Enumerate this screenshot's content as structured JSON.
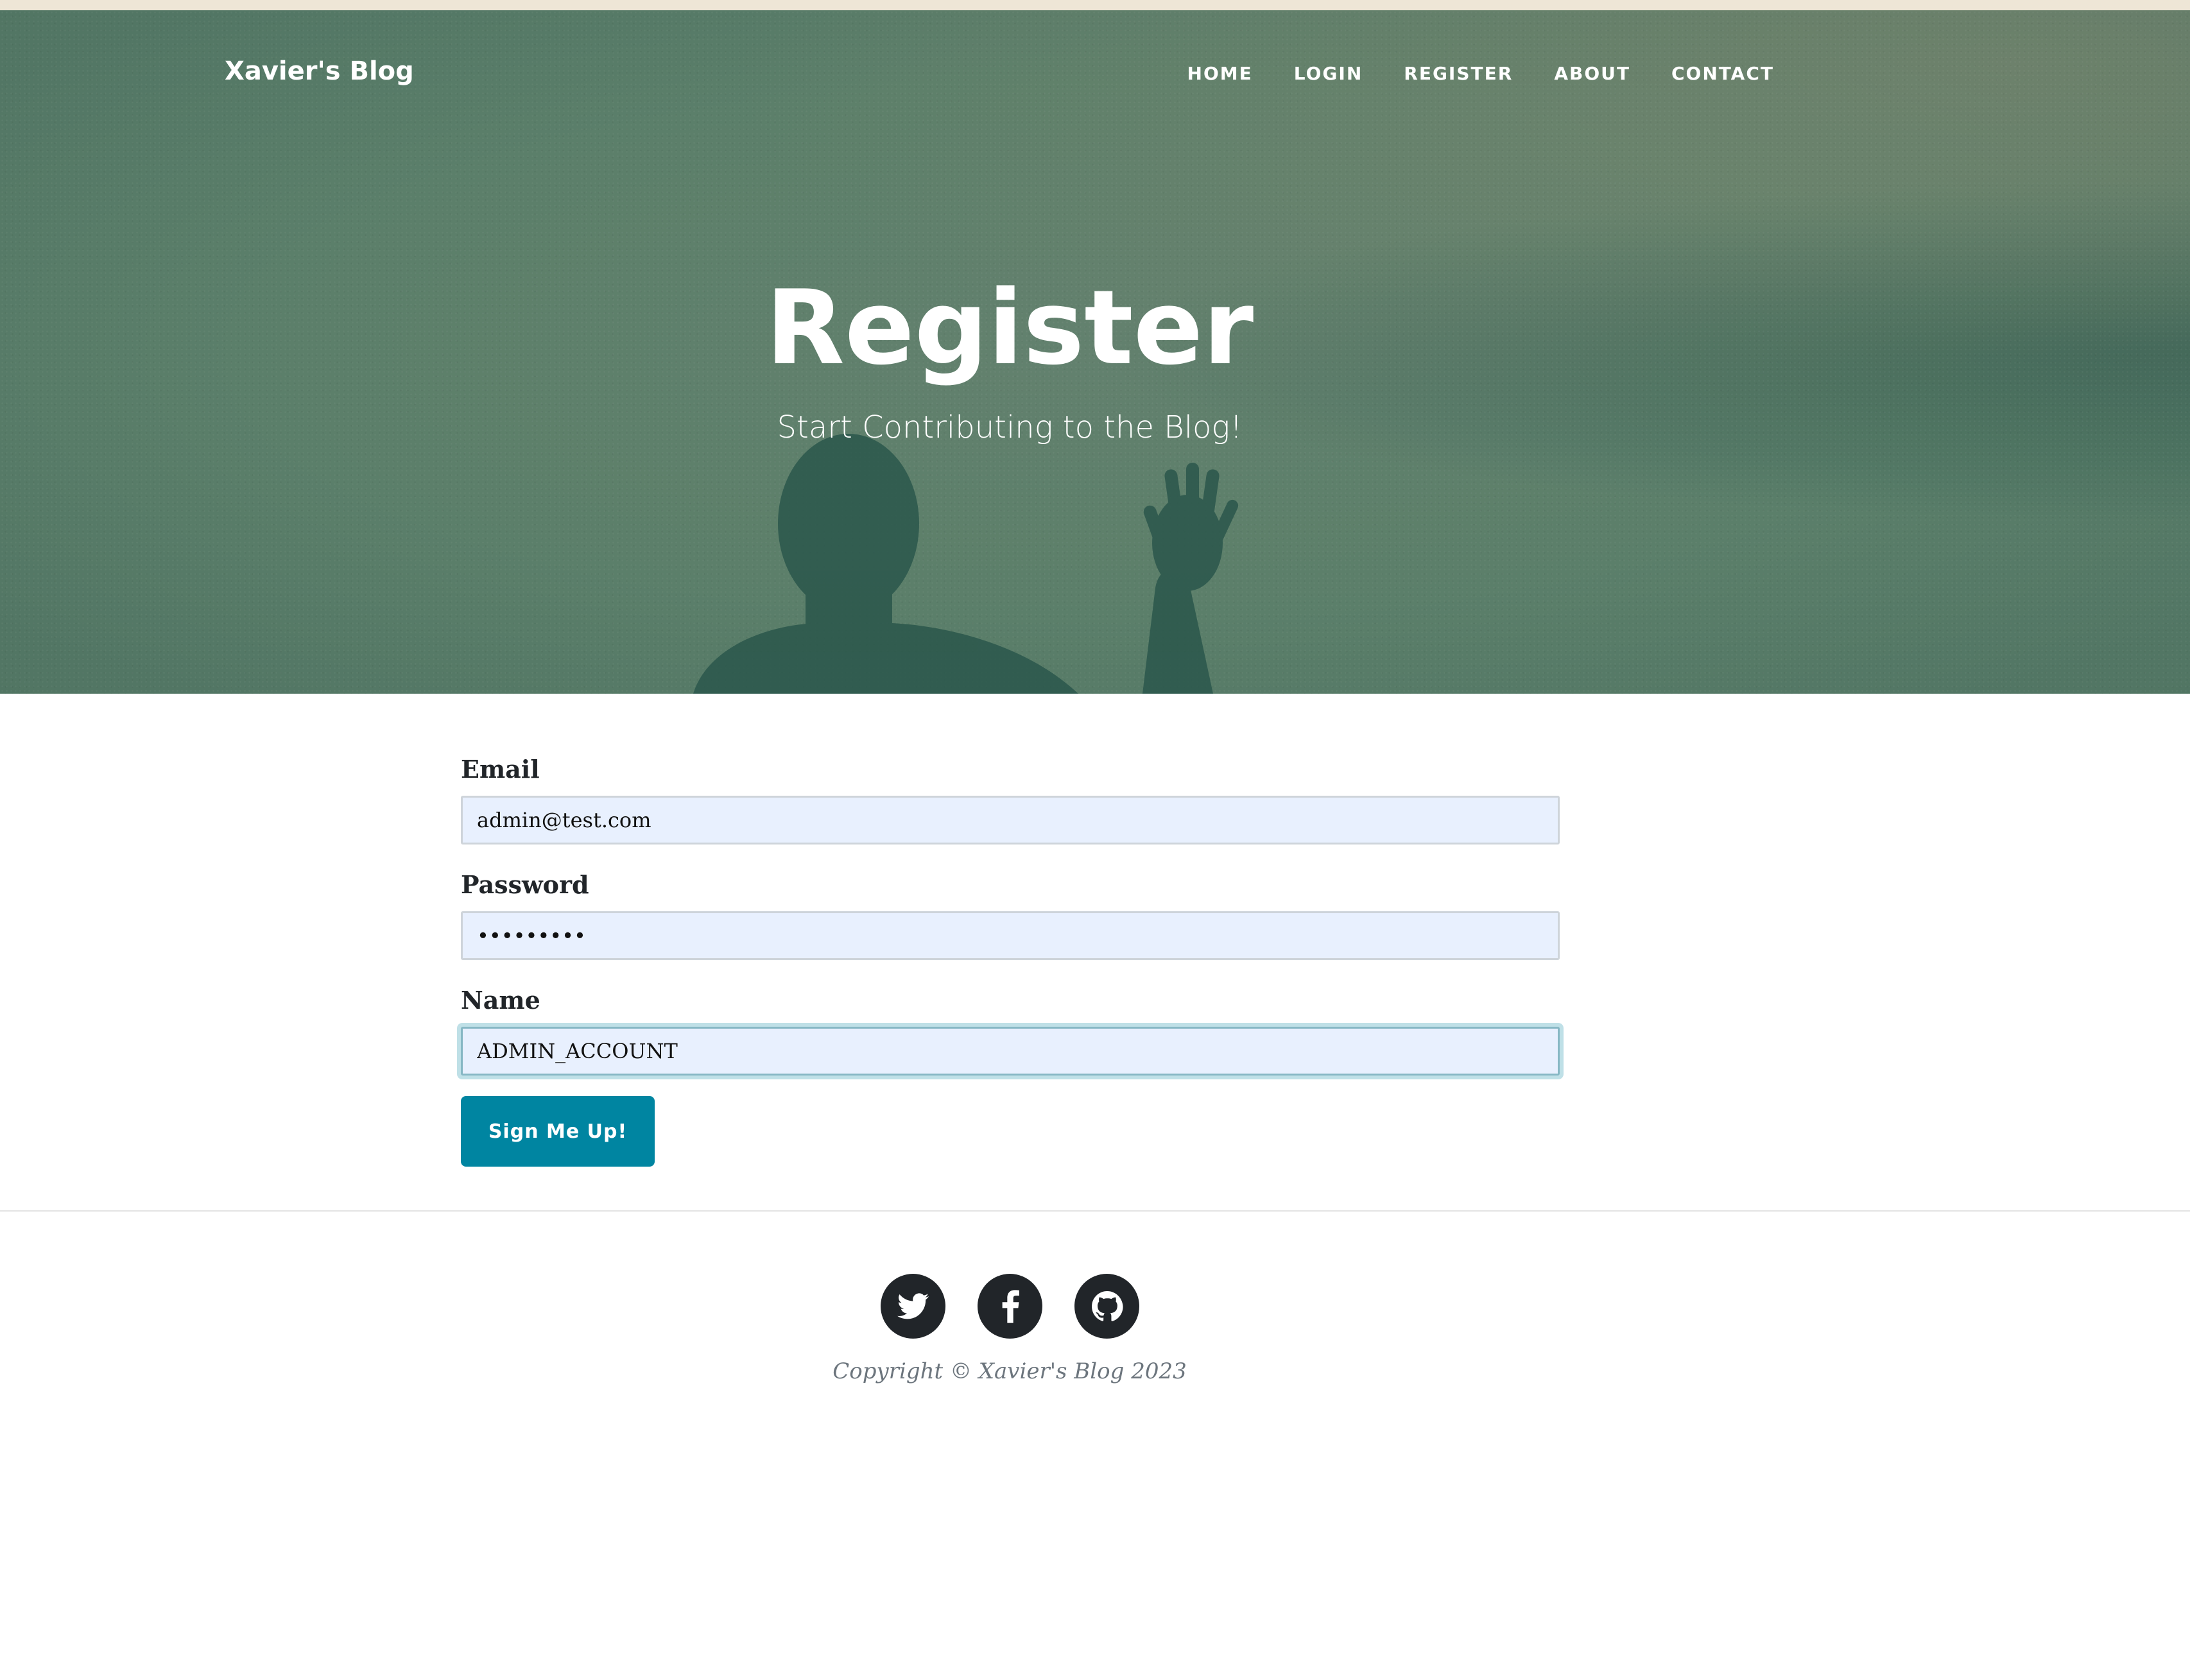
{
  "header": {
    "brand": "Xavier's Blog",
    "nav": [
      {
        "label": "HOME"
      },
      {
        "label": "LOGIN"
      },
      {
        "label": "REGISTER"
      },
      {
        "label": "ABOUT"
      },
      {
        "label": "CONTACT"
      }
    ]
  },
  "hero": {
    "title": "Register",
    "subtitle": "Start Contributing to the Blog!"
  },
  "form": {
    "email": {
      "label": "Email",
      "value": "admin@test.com"
    },
    "password": {
      "label": "Password",
      "value": "•••••••••"
    },
    "name": {
      "label": "Name",
      "value": "ADMIN_ACCOUNT"
    },
    "submit_label": "Sign Me Up!"
  },
  "footer": {
    "social": [
      {
        "icon": "twitter-icon"
      },
      {
        "icon": "facebook-icon"
      },
      {
        "icon": "github-icon"
      }
    ],
    "copyright": "Copyright © Xavier's Blog 2023"
  },
  "colors": {
    "accent": "#0085a1",
    "hero_bg": "#638a73",
    "text_dark": "#212529",
    "input_bg": "#e8f0fe"
  }
}
